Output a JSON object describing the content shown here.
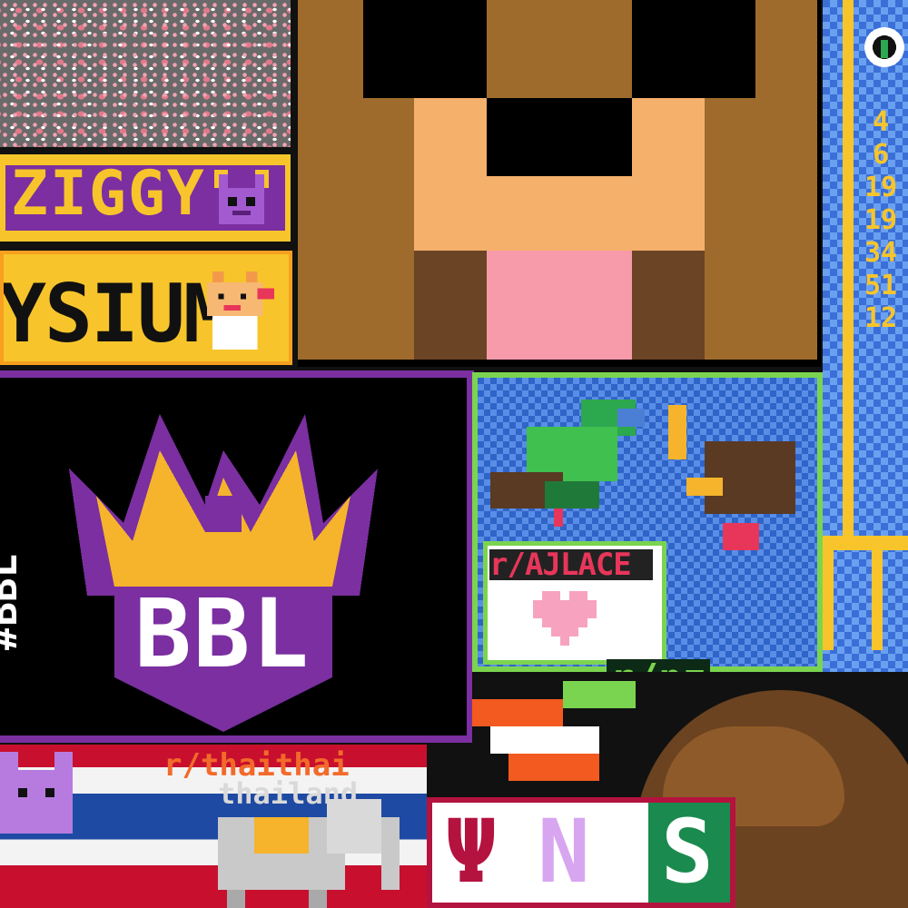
{
  "canvas": {
    "texts": {
      "ziggy": "ZIGGY",
      "ysium": "YSIUM",
      "bbl": "BBL",
      "bbl_hash": "#BBL",
      "rnz": "r/nz",
      "place": "r/AJLACE",
      "thai_title": "r/thaithai",
      "thai_sub": "thailand",
      "wns_psi": "Ψ",
      "wns_n": "N",
      "wns_s": "S"
    },
    "right_strip_numbers": [
      "4",
      "6",
      "19",
      "19",
      "34",
      "51",
      "12"
    ],
    "colors": {
      "purple": "#7b2fa0",
      "gold": "#f7c52b",
      "steve_brown": "#9e6b2d",
      "nz_green": "#7bd44f",
      "nz_blue": "#2f64c8",
      "wns_red": "#b4123f",
      "wns_green": "#1a8a4e",
      "thai_red": "#c8102e",
      "thai_blue": "#1f4aa3"
    }
  }
}
